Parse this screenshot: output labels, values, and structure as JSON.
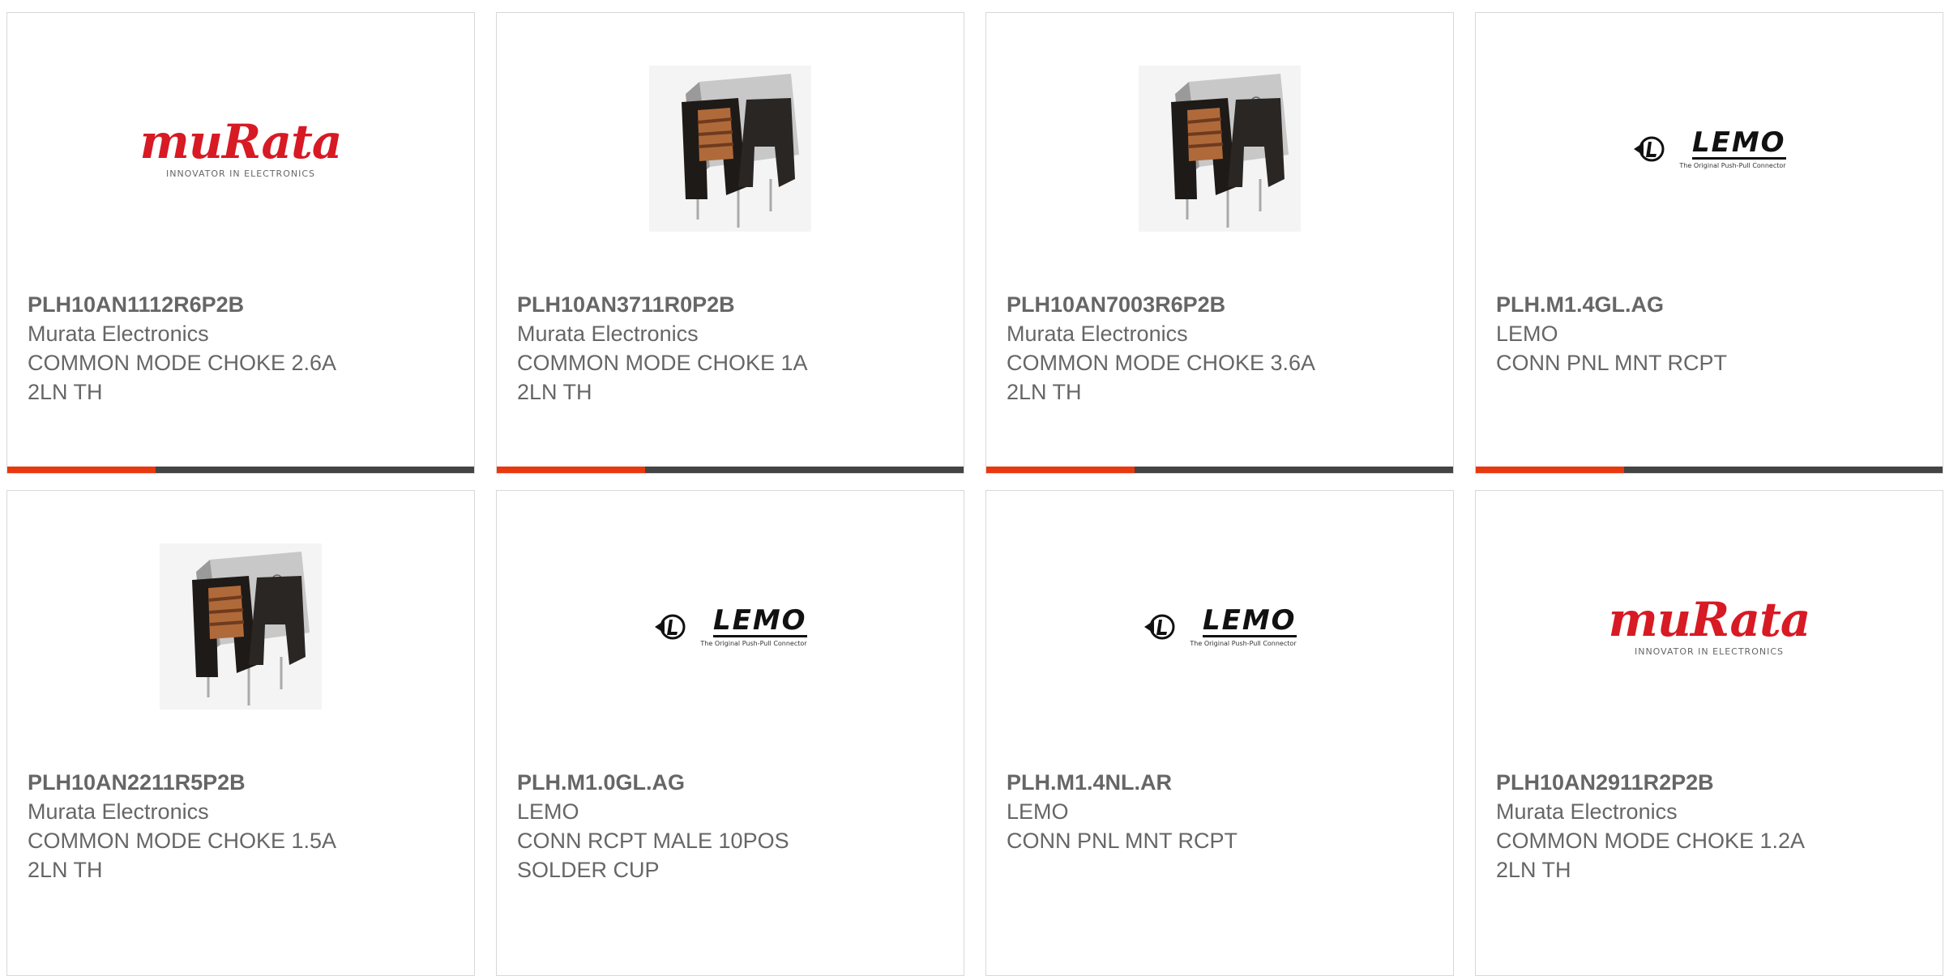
{
  "products": [
    {
      "part_number": "PLH10AN1112R6P2B",
      "manufacturer": "Murata Electronics",
      "description_lines": [
        "COMMON MODE CHOKE 2.6A",
        "2LN TH"
      ],
      "image": "murata-logo",
      "logo_text": "muRata",
      "logo_tagline": "INNOVATOR IN ELECTRONICS"
    },
    {
      "part_number": "PLH10AN3711R0P2B",
      "manufacturer": "Murata Electronics",
      "description_lines": [
        "COMMON MODE CHOKE 1A",
        "2LN TH"
      ],
      "image": "choke-photo"
    },
    {
      "part_number": "PLH10AN7003R6P2B",
      "manufacturer": "Murata Electronics",
      "description_lines": [
        "COMMON MODE CHOKE 3.6A",
        "2LN TH"
      ],
      "image": "choke-photo"
    },
    {
      "part_number": "PLH.M1.4GL.AG",
      "manufacturer": "LEMO",
      "description_lines": [
        "CONN PNL MNT RCPT"
      ],
      "image": "lemo-logo",
      "logo_text": "LEMO",
      "logo_tagline": "The Original Push-Pull Connector"
    },
    {
      "part_number": "PLH10AN2211R5P2B",
      "manufacturer": "Murata Electronics",
      "description_lines": [
        "COMMON MODE CHOKE 1.5A",
        "2LN TH"
      ],
      "image": "choke-photo"
    },
    {
      "part_number": "PLH.M1.0GL.AG",
      "manufacturer": "LEMO",
      "description_lines": [
        "CONN RCPT MALE 10POS",
        "SOLDER CUP"
      ],
      "image": "lemo-logo",
      "logo_text": "LEMO",
      "logo_tagline": "The Original Push-Pull Connector"
    },
    {
      "part_number": "PLH.M1.4NL.AR",
      "manufacturer": "LEMO",
      "description_lines": [
        "CONN PNL MNT RCPT"
      ],
      "image": "lemo-logo",
      "logo_text": "LEMO",
      "logo_tagline": "The Original Push-Pull Connector"
    },
    {
      "part_number": "PLH10AN2911R2P2B",
      "manufacturer": "Murata Electronics",
      "description_lines": [
        "COMMON MODE CHOKE 1.2A",
        "2LN TH"
      ],
      "image": "murata-logo",
      "logo_text": "muRata",
      "logo_tagline": "INNOVATOR IN ELECTRONICS"
    }
  ],
  "colors": {
    "accent": "#e8380d",
    "bar": "#444444",
    "text": "#666666",
    "border": "#d8d8d8",
    "murata_red": "#d71a24"
  }
}
